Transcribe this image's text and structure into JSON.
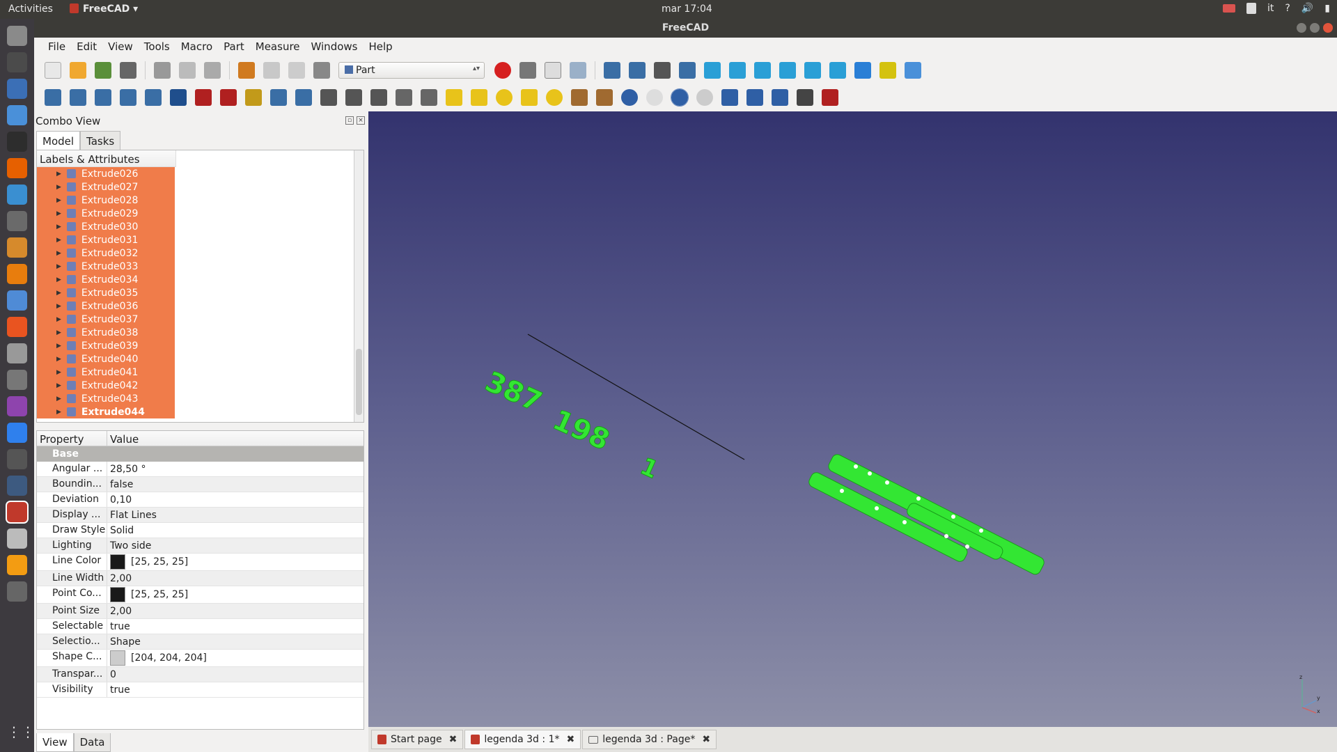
{
  "topbar": {
    "activities": "Activities",
    "app_name": "FreeCAD",
    "clock": "mar 17:04",
    "keyboard_layout": "it",
    "help": "?"
  },
  "window": {
    "title": "FreeCAD"
  },
  "menubar": [
    "File",
    "Edit",
    "View",
    "Tools",
    "Macro",
    "Part",
    "Measure",
    "Windows",
    "Help"
  ],
  "toolbar": {
    "workbench": "Part"
  },
  "combo": {
    "title": "Combo View",
    "tabs": [
      "Model",
      "Tasks"
    ],
    "bottom_tabs": [
      "View",
      "Data"
    ]
  },
  "tree": {
    "header": "Labels & Attributes",
    "items": [
      "Extrude026",
      "Extrude027",
      "Extrude028",
      "Extrude029",
      "Extrude030",
      "Extrude031",
      "Extrude032",
      "Extrude033",
      "Extrude034",
      "Extrude035",
      "Extrude036",
      "Extrude037",
      "Extrude038",
      "Extrude039",
      "Extrude040",
      "Extrude041",
      "Extrude042",
      "Extrude043",
      "Extrude044"
    ]
  },
  "properties": {
    "col_property": "Property",
    "col_value": "Value",
    "group": "Base",
    "rows": [
      {
        "name": "Angular ...",
        "value": "28,50 °"
      },
      {
        "name": "Boundin...",
        "value": "false"
      },
      {
        "name": "Deviation",
        "value": "0,10"
      },
      {
        "name": "Display ...",
        "value": "Flat Lines"
      },
      {
        "name": "Draw Style",
        "value": "Solid"
      },
      {
        "name": "Lighting",
        "value": "Two side"
      },
      {
        "name": "Line Color",
        "value": "[25, 25, 25]",
        "swatch": "#191919"
      },
      {
        "name": "Line Width",
        "value": "2,00"
      },
      {
        "name": "Point Co...",
        "value": "[25, 25, 25]",
        "swatch": "#191919"
      },
      {
        "name": "Point Size",
        "value": "2,00"
      },
      {
        "name": "Selectable",
        "value": "true"
      },
      {
        "name": "Selectio...",
        "value": "Shape"
      },
      {
        "name": "Shape C...",
        "value": "[204, 204, 204]",
        "swatch": "#cccccc"
      },
      {
        "name": "Transpar...",
        "value": "0"
      },
      {
        "name": "Visibility",
        "value": "true"
      }
    ]
  },
  "doc_tabs": [
    {
      "label": "Start page",
      "icon": "freecad-icon"
    },
    {
      "label": "legenda 3d : 1*",
      "icon": "freecad-icon",
      "active": true
    },
    {
      "label": "legenda 3d : Page*",
      "icon": "page-icon"
    }
  ],
  "viewport": {
    "text_3d": [
      "387",
      "198",
      "1"
    ],
    "axis_labels": [
      "z",
      "y",
      "x"
    ],
    "colors": {
      "model": "#33e633",
      "bg_top": "#33336e",
      "bg_bottom": "#8d8fa8",
      "selection": "#f07c4a"
    }
  }
}
